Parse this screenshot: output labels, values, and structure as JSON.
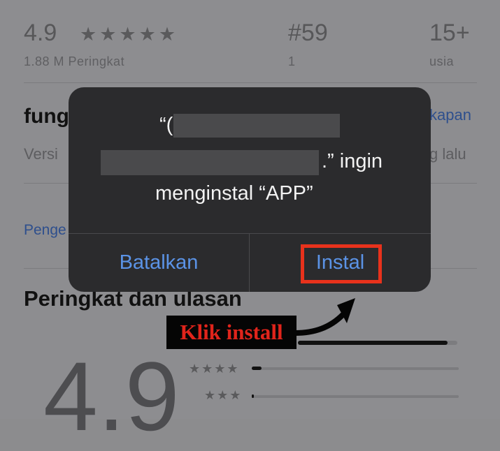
{
  "stats": {
    "rating_value": "4.9",
    "rating_stars": "★★★★★",
    "rating_count": "1.88 M Peringkat",
    "rank_value": "#59",
    "rank_sub": "1",
    "age_value": "15+",
    "age_label": "usia"
  },
  "whats_new": {
    "title_partial": "fung",
    "history_link_partial": "kapan",
    "version_partial": "Versi",
    "time_partial": "g lalu"
  },
  "developer_link_partial": "Penge",
  "ratings_section": {
    "title": "Peringkat dan ulasan",
    "big_rating": "4.9",
    "row_stars_4": "★★★★",
    "row_stars_3": "★★★"
  },
  "dialog": {
    "quote_open": "“(",
    "line2_suffix": ".” ingin",
    "line3": "menginstal “APP”",
    "cancel_label": "Batalkan",
    "install_label": "Instal"
  },
  "annotation": {
    "text": "Klik install"
  },
  "colors": {
    "dialog_bg": "#2b2b2d",
    "button_blue": "#5b93e6",
    "highlight_red": "#e8321c",
    "annotation_red": "#e0241b"
  }
}
